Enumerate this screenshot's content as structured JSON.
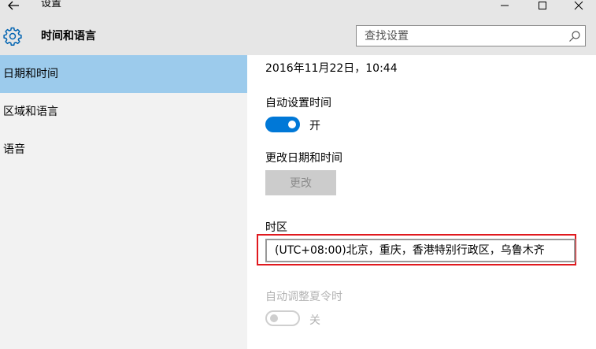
{
  "window": {
    "title": "设置",
    "back_icon": "arrow-left-icon",
    "controls": [
      "minimize-icon",
      "maximize-icon",
      "close-icon"
    ]
  },
  "header": {
    "icon": "gear-icon",
    "title": "时间和语言",
    "search": {
      "placeholder": "查找设置",
      "value": ""
    }
  },
  "sidebar": {
    "items": [
      {
        "label": "日期和时间",
        "selected": true
      },
      {
        "label": "区域和语言",
        "selected": false
      },
      {
        "label": "语音",
        "selected": false
      }
    ]
  },
  "main": {
    "current_datetime": "2016年11月22日，10:44",
    "auto_time": {
      "label": "自动设置时间",
      "state": "开",
      "on": true
    },
    "change_datetime": {
      "label": "更改日期和时间",
      "button": "更改",
      "enabled": false
    },
    "timezone": {
      "label": "时区",
      "value": "(UTC+08:00)北京，重庆，香港特别行政区，乌鲁木齐"
    },
    "dst": {
      "label": "自动调整夏令时",
      "state": "关",
      "on": false,
      "enabled": false
    }
  },
  "colors": {
    "accent": "#0078d7",
    "selected_nav": "#9ccbec",
    "highlight_box": "#e0191e",
    "header_bg": "#e6e6e6",
    "sidebar_bg": "#f2f2f2"
  }
}
